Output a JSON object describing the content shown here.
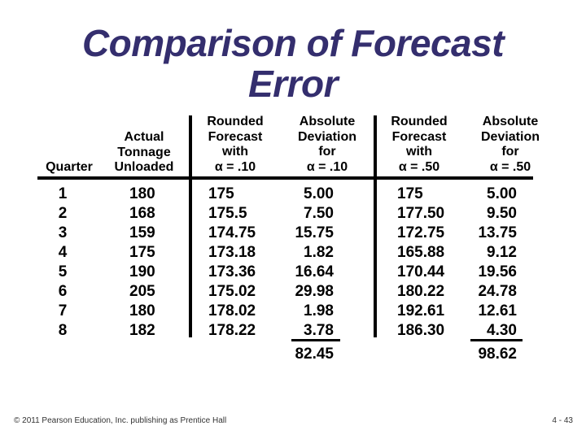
{
  "title": {
    "line1": "Comparison of Forecast",
    "line2": "Error"
  },
  "headers": {
    "quarter": [
      "Quarter"
    ],
    "actual": [
      "Actual",
      "Tonnage",
      "Unloaded"
    ],
    "forecast_10": [
      "Rounded",
      "Forecast",
      "with",
      "α = .10"
    ],
    "deviation_10": [
      "Absolute",
      "Deviation",
      "for",
      "α = .10"
    ],
    "forecast_50": [
      "Rounded",
      "Forecast",
      "with",
      "α = .50"
    ],
    "deviation_50": [
      "Absolute",
      "Deviation",
      "for",
      "α = .50"
    ]
  },
  "columns": {
    "quarter": [
      "1",
      "2",
      "3",
      "4",
      "5",
      "6",
      "7",
      "8"
    ],
    "actual": [
      "180",
      "168",
      "159",
      "175",
      "190",
      "205",
      "180",
      "182"
    ],
    "forecast_10": [
      "175",
      "175.5",
      "174.75",
      "173.18",
      "173.36",
      "175.02",
      "178.02",
      "178.22"
    ],
    "deviation_10": [
      "5.00",
      "7.50",
      "15.75",
      "1.82",
      "16.64",
      "29.98",
      "1.98",
      "3.78"
    ],
    "forecast_50": [
      "175",
      "177.50",
      "172.75",
      "165.88",
      "170.44",
      "180.22",
      "192.61",
      "186.30"
    ],
    "deviation_50": [
      "5.00",
      "9.50",
      "13.75",
      "9.12",
      "19.56",
      "24.78",
      "12.61",
      "4.30"
    ]
  },
  "totals": {
    "deviation_10": "82.45",
    "deviation_50": "98.62"
  },
  "footer": {
    "copyright": "© 2011 Pearson Education, Inc. publishing as Prentice Hall",
    "page": "4 - 43"
  },
  "colors": {
    "title": "#342E6E"
  }
}
